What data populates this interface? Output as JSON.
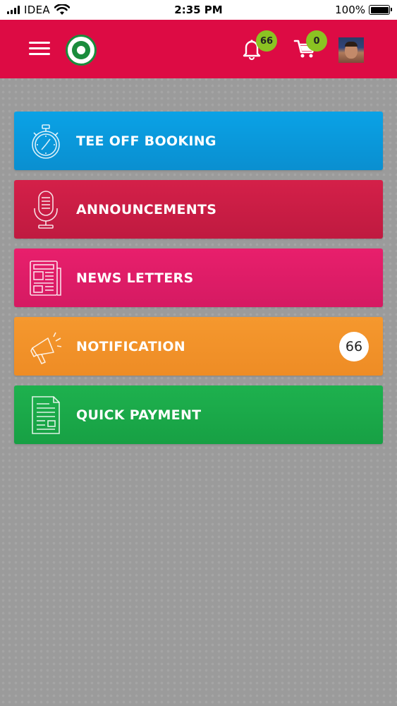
{
  "status_bar": {
    "carrier": "IDEA",
    "time": "2:35 PM",
    "battery": "100%"
  },
  "header": {
    "menu_icon": "hamburger-icon",
    "logo_icon": "golf-club-logo",
    "notifications_count": "66",
    "cart_count": "0",
    "bell_icon": "bell-icon",
    "cart_icon": "cart-icon",
    "avatar_icon": "user-avatar"
  },
  "menu": {
    "items": [
      {
        "label": "TEE OFF BOOKING",
        "icon": "stopwatch-icon",
        "color": "#0a9bdd"
      },
      {
        "label": "ANNOUNCEMENTS",
        "icon": "microphone-icon",
        "color": "#c81d45"
      },
      {
        "label": "NEWS LETTERS",
        "icon": "newspaper-icon",
        "color": "#e01d67"
      },
      {
        "label": "NOTIFICATION",
        "icon": "megaphone-icon",
        "color": "#f2922a",
        "count": "66"
      },
      {
        "label": "QUICK PAYMENT",
        "icon": "invoice-icon",
        "color": "#1aa94a"
      }
    ]
  },
  "colors": {
    "header_bg": "#dd0b44",
    "badge_bg": "#8bc322",
    "page_bg": "#9b9b9b"
  }
}
